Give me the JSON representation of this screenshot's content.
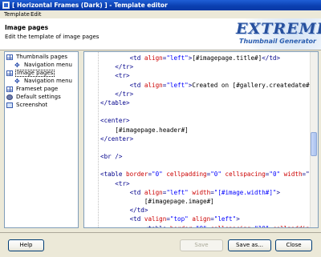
{
  "window": {
    "title": "[ Horizontal Frames (Dark) ] - Template editor"
  },
  "menu": {
    "template": "Template",
    "edit": "Edit"
  },
  "header": {
    "title": "Image pages",
    "subtitle": "Edit the template of image pages",
    "logo_main": "EXTREME",
    "logo_sub": "Thumbnail Generator"
  },
  "tree": {
    "items": [
      {
        "label": "Thumbnails pages",
        "icon": "grid-page-icon"
      },
      {
        "label": "Navigation menu",
        "icon": "navigation-icon"
      },
      {
        "label": "Image pages",
        "icon": "grid-page-icon",
        "selected": true
      },
      {
        "label": "Navigation menu",
        "icon": "navigation-icon"
      },
      {
        "label": "Frameset page",
        "icon": "grid-page-icon"
      },
      {
        "label": "Default settings",
        "icon": "gear-icon"
      },
      {
        "label": "Screenshot",
        "icon": "screenshot-icon"
      }
    ]
  },
  "editor": {
    "lines": [
      [
        [
          "tx",
          "        "
        ],
        [
          "tg",
          "<td "
        ],
        [
          "at",
          "align"
        ],
        [
          "tg",
          "="
        ],
        [
          "vl",
          "\"left\""
        ],
        [
          "tg",
          ">"
        ],
        [
          "tx",
          "[#imagepage.title#]"
        ],
        [
          "tg",
          "</td>"
        ]
      ],
      [
        [
          "tx",
          "    "
        ],
        [
          "tg",
          "</tr>"
        ]
      ],
      [
        [
          "tx",
          "    "
        ],
        [
          "tg",
          "<tr>"
        ]
      ],
      [
        [
          "tx",
          "        "
        ],
        [
          "tg",
          "<td "
        ],
        [
          "at",
          "align"
        ],
        [
          "tg",
          "="
        ],
        [
          "vl",
          "\"left\""
        ],
        [
          "tg",
          ">"
        ],
        [
          "tx",
          "Created on [#gallery.createdate#]"
        ]
      ],
      [
        [
          "tx",
          "    "
        ],
        [
          "tg",
          "</tr>"
        ]
      ],
      [
        [
          "tg",
          "</table>"
        ]
      ],
      [
        [
          "tx",
          ""
        ]
      ],
      [
        [
          "tg",
          "<center>"
        ]
      ],
      [
        [
          "tx",
          "    [#imagepage.header#]"
        ]
      ],
      [
        [
          "tg",
          "</center>"
        ]
      ],
      [
        [
          "tx",
          ""
        ]
      ],
      [
        [
          "tg",
          "<br />"
        ]
      ],
      [
        [
          "tx",
          ""
        ]
      ],
      [
        [
          "tg",
          "<table "
        ],
        [
          "at",
          "border"
        ],
        [
          "tg",
          "="
        ],
        [
          "vl",
          "\"0\" "
        ],
        [
          "at",
          "cellpadding"
        ],
        [
          "tg",
          "="
        ],
        [
          "vl",
          "\"0\" "
        ],
        [
          "at",
          "cellspacing"
        ],
        [
          "tg",
          "="
        ],
        [
          "vl",
          "\"0\" "
        ],
        [
          "at",
          "width"
        ],
        [
          "tg",
          "=\""
        ]
      ],
      [
        [
          "tx",
          "    "
        ],
        [
          "tg",
          "<tr>"
        ]
      ],
      [
        [
          "tx",
          "        "
        ],
        [
          "tg",
          "<td "
        ],
        [
          "at",
          "align"
        ],
        [
          "tg",
          "="
        ],
        [
          "vl",
          "\"left\" "
        ],
        [
          "at",
          "width"
        ],
        [
          "tg",
          "="
        ],
        [
          "vl",
          "\"[#image.width#]\""
        ],
        [
          "tg",
          ">"
        ]
      ],
      [
        [
          "tx",
          "            [#imagepage.image#]"
        ]
      ],
      [
        [
          "tx",
          "        "
        ],
        [
          "tg",
          "</td>"
        ]
      ],
      [
        [
          "tx",
          "        "
        ],
        [
          "tg",
          "<td "
        ],
        [
          "at",
          "valign"
        ],
        [
          "tg",
          "="
        ],
        [
          "vl",
          "\"top\" "
        ],
        [
          "at",
          "align"
        ],
        [
          "tg",
          "="
        ],
        [
          "vl",
          "\"left\""
        ],
        [
          "tg",
          ">"
        ]
      ],
      [
        [
          "tx",
          "            "
        ],
        [
          "tg",
          "<table "
        ],
        [
          "at",
          "border"
        ],
        [
          "tg",
          "="
        ],
        [
          "vl",
          "\"0\" "
        ],
        [
          "at",
          "cellspacing"
        ],
        [
          "tg",
          "="
        ],
        [
          "vl",
          "\"10\" "
        ],
        [
          "at",
          "cellpaddin"
        ]
      ],
      [
        [
          "tx",
          "                "
        ],
        [
          "tg",
          "<tr>"
        ]
      ],
      [
        [
          "tx",
          "                    "
        ],
        [
          "tg",
          "<td "
        ],
        [
          "at",
          "align"
        ],
        [
          "tg",
          "="
        ],
        [
          "vl",
          "\"left\""
        ],
        [
          "tg",
          "><b>"
        ],
        [
          "tx",
          "File name:"
        ],
        [
          "tg",
          "</b> </"
        ]
      ]
    ]
  },
  "buttons": {
    "help": "Help",
    "save": "Save",
    "save_as": "Save as...",
    "close": "Close"
  }
}
